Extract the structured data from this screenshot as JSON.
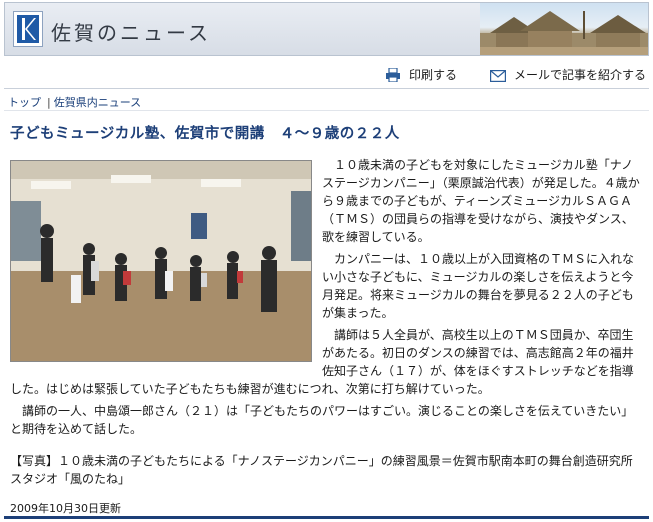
{
  "header": {
    "title": "佐賀のニュース"
  },
  "utility": {
    "print_label": "印刷する",
    "mail_label": "メールで記事を紹介する"
  },
  "breadcrumb": {
    "items": [
      "トップ",
      "佐賀県内ニュース"
    ]
  },
  "article": {
    "headline": "子どもミュージカル塾、佐賀市で開講　４～９歳の２２人",
    "paragraphs": [
      "　１０歳未満の子どもを対象にしたミュージカル塾「ナノステージカンパニー」（栗原誠治代表）が発足した。４歳から９歳までの子どもが、ティーンズミュージカルＳＡＧＡ（ＴＭＳ）の団員らの指導を受けながら、演技やダンス、歌を練習している。",
      "　カンパニーは、１０歳以上が入団資格のＴＭＳに入れない小さな子どもに、ミュージカルの楽しさを伝えようと今月発足。将来ミュージカルの舞台を夢見る２２人の子どもが集まった。",
      "　講師は５人全員が、高校生以上のＴＭＳ団員か、卒団生があたる。初日のダンスの練習では、高志館高２年の福井佐知子さん（１７）が、体をほぐすストレッチなどを指導した。はじめは緊張していた子どもたちも練習が進むにつれ、次第に打ち解けていった。",
      "　講師の一人、中島頌一郎さん（２１）は「子どもたちのパワーはすごい。演じることの楽しさを伝えていきたい」と期待を込めて話した。"
    ],
    "caption": "【写真】１０歳未満の子どもたちによる「ナノステージカンパニー」の練習風景＝佐賀市駅南本町の舞台創造研究所スタジオ「風のたね」",
    "updated": "2009年10月30日更新"
  }
}
